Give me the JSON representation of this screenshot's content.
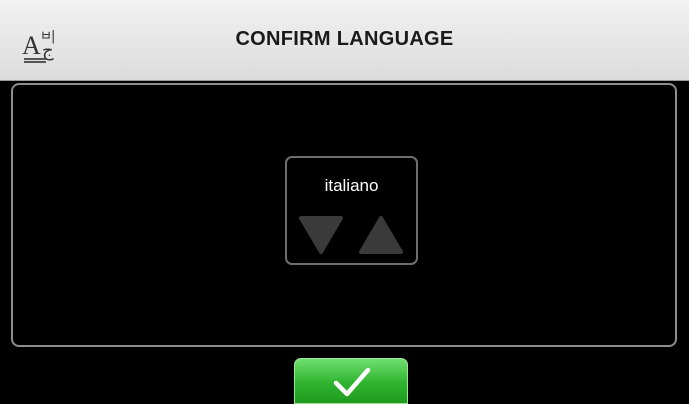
{
  "header": {
    "title": "CONFIRM LANGUAGE",
    "icon": "language-icon"
  },
  "language_selector": {
    "current_language": "italiano",
    "down_icon": "triangle-down-icon",
    "up_icon": "triangle-up-icon"
  },
  "confirm": {
    "icon": "checkmark-icon"
  },
  "colors": {
    "header_bg": "#e6e6e6",
    "accent_red": "#e60012",
    "confirm_green": "#2fb32f",
    "panel_border": "#8c8c8c"
  }
}
